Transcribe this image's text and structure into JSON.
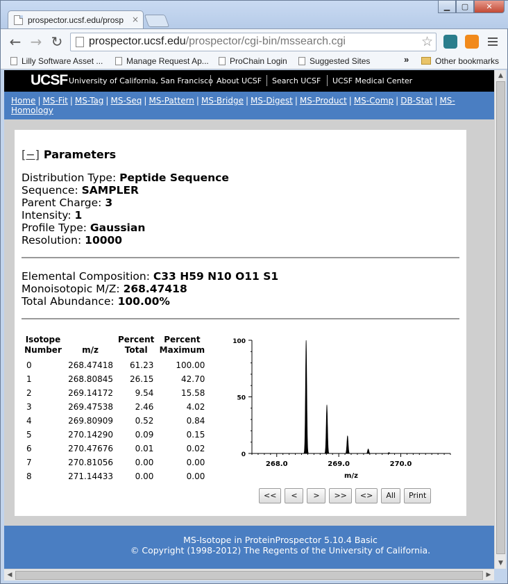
{
  "browser": {
    "tab_title": "prospector.ucsf.edu/prosp",
    "tab_close": "×",
    "url_host": "prospector.ucsf.edu",
    "url_path": "/prospector/cgi-bin/mssearch.cgi",
    "window_controls": [
      "▁",
      "▢",
      "✕"
    ],
    "back": "←",
    "forward": "→",
    "reload": "↻",
    "star": "☆",
    "bookmarks": [
      "Lilly Software Asset ...",
      "Manage Request Ap...",
      "ProChain Login",
      "Suggested Sites"
    ],
    "bookmarks_more": "»",
    "other_bookmarks": "Other bookmarks"
  },
  "ucsf_bar": {
    "logo": "UCSF",
    "links": [
      "University of California, San Francisco",
      "About UCSF",
      "Search UCSF",
      "UCSF Medical Center"
    ]
  },
  "nav_links": [
    "Home",
    "MS-Fit",
    "MS-Tag",
    "MS-Seq",
    "MS-Pattern",
    "MS-Bridge",
    "MS-Digest",
    "MS-Product",
    "MS-Comp",
    "DB-Stat",
    "MS-",
    "Homology"
  ],
  "parameters": {
    "toggle": "[−]",
    "title": "Parameters",
    "items": [
      {
        "label": "Distribution Type:",
        "value": "Peptide Sequence"
      },
      {
        "label": "Sequence:",
        "value": "SAMPLER"
      },
      {
        "label": "Parent Charge:",
        "value": "3"
      },
      {
        "label": "Intensity:",
        "value": "1"
      },
      {
        "label": "Profile Type:",
        "value": "Gaussian"
      },
      {
        "label": "Resolution:",
        "value": "10000"
      }
    ]
  },
  "composition": [
    {
      "label": "Elemental Composition:",
      "value": "C33 H59 N10 O11 S1"
    },
    {
      "label": "Monoisotopic M/Z:",
      "value": "268.47418"
    },
    {
      "label": "Total Abundance:",
      "value": "100.00%"
    }
  ],
  "isotope_table": {
    "headers": [
      "Isotope\nNumber",
      "m/z",
      "Percent\nTotal",
      "Percent\nMaximum"
    ],
    "rows": [
      [
        "0",
        "268.47418",
        "61.23",
        "100.00"
      ],
      [
        "1",
        "268.80845",
        "26.15",
        "42.70"
      ],
      [
        "2",
        "269.14172",
        "9.54",
        "15.58"
      ],
      [
        "3",
        "269.47538",
        "2.46",
        "4.02"
      ],
      [
        "4",
        "269.80909",
        "0.52",
        "0.84"
      ],
      [
        "5",
        "270.14290",
        "0.09",
        "0.15"
      ],
      [
        "6",
        "270.47676",
        "0.01",
        "0.02"
      ],
      [
        "7",
        "270.81056",
        "0.00",
        "0.00"
      ],
      [
        "8",
        "271.14433",
        "0.00",
        "0.00"
      ]
    ]
  },
  "chart_data": {
    "type": "line",
    "title": "",
    "xlabel": "m/z",
    "ylabel": "",
    "xlim": [
      267.6,
      270.8
    ],
    "ylim": [
      0,
      100
    ],
    "x_ticks": [
      "268.0",
      "269.0",
      "270.0"
    ],
    "x_tick_values": [
      268.0,
      269.0,
      270.0
    ],
    "y_ticks": [
      "100",
      "50",
      "0"
    ],
    "y_tick_values": [
      100,
      50,
      0
    ],
    "peaks": [
      {
        "mz": 268.47418,
        "percent_max": 100.0
      },
      {
        "mz": 268.80845,
        "percent_max": 42.7
      },
      {
        "mz": 269.14172,
        "percent_max": 15.58
      },
      {
        "mz": 269.47538,
        "percent_max": 4.02
      },
      {
        "mz": 269.80909,
        "percent_max": 0.84
      },
      {
        "mz": 270.1429,
        "percent_max": 0.15
      }
    ]
  },
  "chart_controls": [
    "<<",
    "<",
    ">",
    ">>",
    "<>",
    "All",
    "Print"
  ],
  "footer": {
    "line1": "MS-Isotope in ProteinProspector 5.10.4 Basic",
    "line2": "© Copyright (1998-2012) The Regents of the University of California."
  }
}
